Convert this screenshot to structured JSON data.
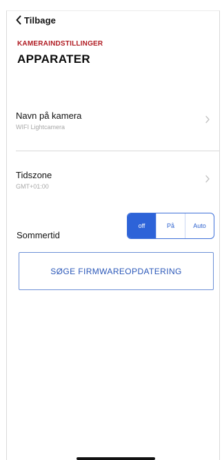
{
  "nav": {
    "back_label": "Tilbage"
  },
  "header": {
    "subtitle": "KAMERAINDSTILLINGER",
    "title": "APPARATER"
  },
  "settings": {
    "camera_name": {
      "label": "Navn på kamera",
      "value": "WIFI Lightcamera"
    },
    "timezone": {
      "label": "Tidszone",
      "value": "GMT+01:00"
    }
  },
  "dst": {
    "label": "Sommertid",
    "options": [
      "off",
      "På",
      "Auto"
    ],
    "selected": "off"
  },
  "firmware_button": {
    "label": "SØGE FIRMWAREOPDATERING"
  },
  "colors": {
    "accent": "#2d63d8",
    "header_red": "#b01b22",
    "divider": "#d7d7d7",
    "muted_text": "#a8a8a8"
  },
  "icons": {
    "back": "chevron-left-icon",
    "row_disclosure": "chevron-right-icon"
  }
}
